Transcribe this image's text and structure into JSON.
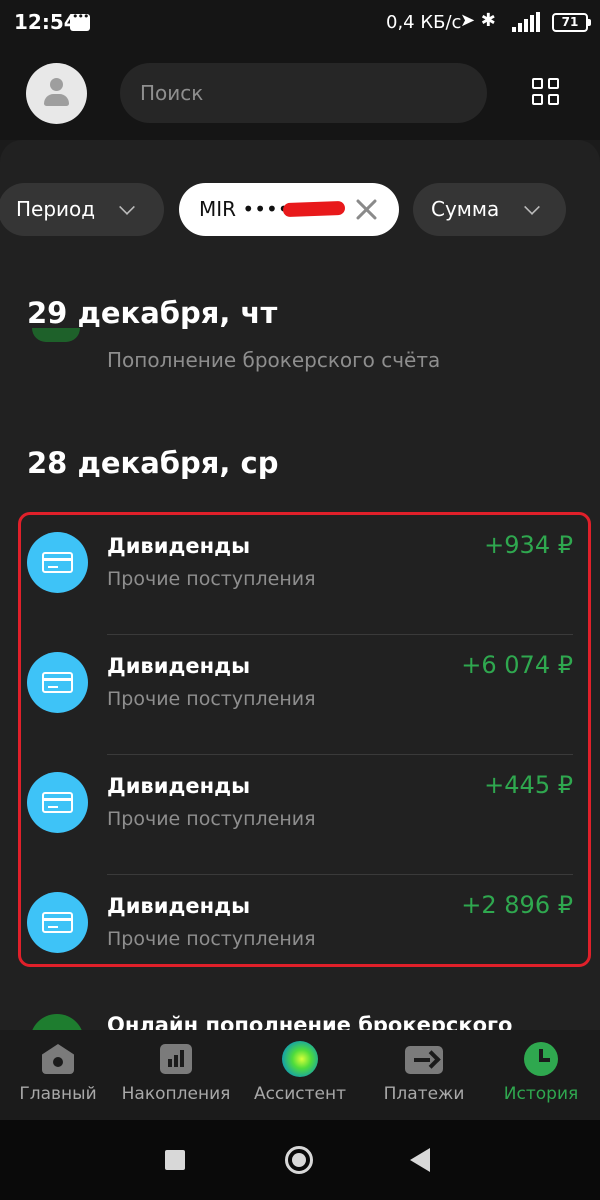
{
  "status_bar": {
    "time": "12:54",
    "speed": "0,4 КБ/с",
    "network": "4G",
    "battery": "71"
  },
  "header": {
    "search_placeholder": "Поиск"
  },
  "filters": {
    "period": "Период",
    "card": "MIR ••••",
    "amount": "Сумма"
  },
  "sections": [
    {
      "date": "29 декабря, чт",
      "last_visible_subtitle": "Пополнение брокерского счёта"
    },
    {
      "date": "28 декабря, ср",
      "transactions": [
        {
          "title": "Дивиденды",
          "subtitle": "Прочие поступления",
          "amount": "+934 ₽"
        },
        {
          "title": "Дивиденды",
          "subtitle": "Прочие поступления",
          "amount": "+6 074 ₽"
        },
        {
          "title": "Дивиденды",
          "subtitle": "Прочие поступления",
          "amount": "+445 ₽"
        },
        {
          "title": "Дивиденды",
          "subtitle": "Прочие поступления",
          "amount": "+2 896 ₽"
        }
      ],
      "next_partial_title": "Онлайн пополнение брокерского"
    }
  ],
  "bottom_nav": [
    {
      "label": "Главный",
      "icon": "home-icon"
    },
    {
      "label": "Накопления",
      "icon": "savings-chart-icon"
    },
    {
      "label": "Ассистент",
      "icon": "assistant-orb-icon"
    },
    {
      "label": "Платежи",
      "icon": "payments-arrow-icon"
    },
    {
      "label": "История",
      "icon": "history-clock-icon",
      "active": true
    }
  ],
  "colors": {
    "accent_green": "#2fa84f",
    "income_icon": "#3ec3f7",
    "highlight_frame": "#e0202a"
  }
}
